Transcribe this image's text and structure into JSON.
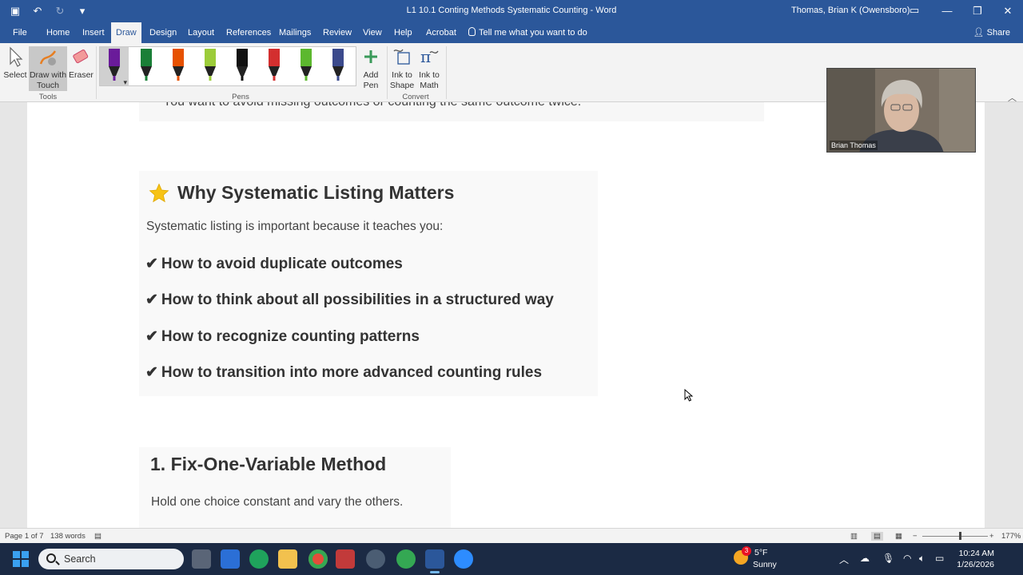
{
  "window": {
    "title": "L1 10.1 Conting Methods Systematic Counting  -  Word",
    "user": "Thomas, Brian K (Owensboro)"
  },
  "menu": {
    "tabs": [
      "File",
      "Home",
      "Insert",
      "Draw",
      "Design",
      "Layout",
      "References",
      "Mailings",
      "Review",
      "View",
      "Help",
      "Acrobat"
    ],
    "active_tab": "Draw",
    "tell_me": "Tell me what you want to do",
    "share": "Share"
  },
  "ribbon": {
    "select": "Select",
    "draw_with_touch": "Draw with Touch",
    "eraser": "Eraser",
    "tools_label": "Tools",
    "pens_label": "Pens",
    "add_pen": "Add Pen",
    "ink_to_shape": "Ink to Shape",
    "ink_to_math": "Ink to Math",
    "convert_label": "Convert",
    "pen_colors": [
      "#6a1b9a",
      "#1a7f37",
      "#e65100",
      "#9ccc3a",
      "#111111",
      "#d32f2f",
      "#5cb82e",
      "#3b4a8c"
    ]
  },
  "document": {
    "cut_line": "You want to avoid missing outcomes or counting the same outcome twice.",
    "section1": {
      "heading": "Why Systematic Listing Matters",
      "intro": "Systematic listing is important because it teaches you:",
      "check": "✔",
      "items": [
        "How to avoid duplicate outcomes",
        "How to think about all possibilities in a structured way",
        "How to recognize counting patterns",
        "How to transition into more advanced counting rules"
      ]
    },
    "section2": {
      "heading": "1. Fix-One-Variable Method",
      "text": "Hold one choice constant and vary the others."
    }
  },
  "webcam": {
    "name": "Brian Thomas"
  },
  "status": {
    "page": "Page 1 of 7",
    "words": "138 words",
    "zoom": "177%"
  },
  "taskbar": {
    "search": "Search",
    "weather_temp": "5°F",
    "weather_cond": "Sunny",
    "weather_badge": "3",
    "time": "10:24 AM",
    "date": "1/26/2026"
  }
}
